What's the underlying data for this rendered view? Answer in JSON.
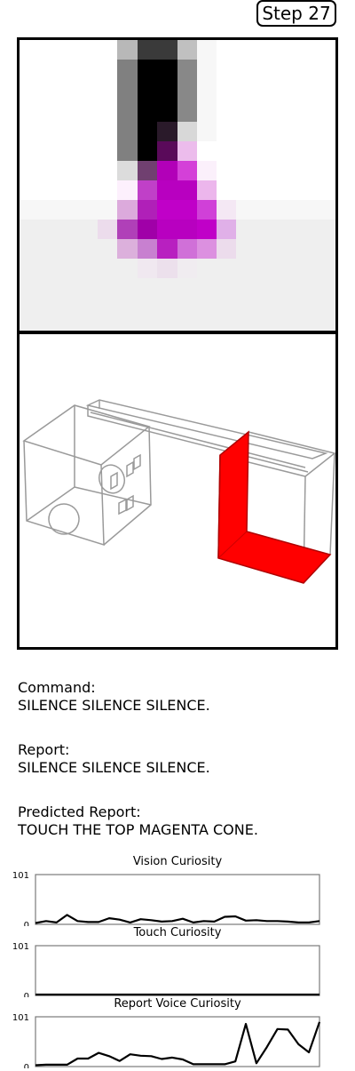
{
  "step": {
    "label": "Step 27"
  },
  "command": {
    "label": "Command:",
    "text": "SILENCE SILENCE SILENCE."
  },
  "report": {
    "label": "Report:",
    "text": "SILENCE SILENCE SILENCE."
  },
  "predicted_report": {
    "label": "Predicted Report:",
    "text": "TOUCH THE TOP MAGENTA CONE."
  },
  "colors": {
    "accent_red": "#ff0000",
    "magenta": "#c000c8"
  },
  "chart_data": [
    {
      "type": "line",
      "title": "Vision Curiosity",
      "ylim": [
        0,
        101
      ],
      "yticks": [
        "0",
        "101"
      ],
      "values": [
        1,
        5,
        2,
        18,
        5,
        3,
        3,
        11,
        8,
        2,
        9,
        7,
        4,
        5,
        10,
        2,
        5,
        4,
        14,
        15,
        6,
        7,
        5,
        5,
        4,
        2,
        2,
        5
      ]
    },
    {
      "type": "line",
      "title": "Touch Curiosity",
      "ylim": [
        0,
        101
      ],
      "yticks": [
        "0",
        "101"
      ],
      "values": [
        0,
        0,
        0,
        0,
        0,
        0,
        0,
        0,
        0,
        0,
        0,
        0,
        0,
        0,
        0,
        0,
        0,
        0,
        0,
        0,
        0,
        0,
        0,
        0,
        0,
        0,
        0,
        0
      ]
    },
    {
      "type": "line",
      "title": "Report Voice Curiosity",
      "ylim": [
        0,
        101
      ],
      "yticks": [
        "0",
        "101"
      ],
      "values": [
        1,
        2,
        2,
        2,
        15,
        15,
        27,
        20,
        10,
        24,
        21,
        20,
        14,
        17,
        13,
        3,
        3,
        3,
        3,
        9,
        88,
        5,
        39,
        77,
        76,
        45,
        28,
        92
      ]
    }
  ]
}
